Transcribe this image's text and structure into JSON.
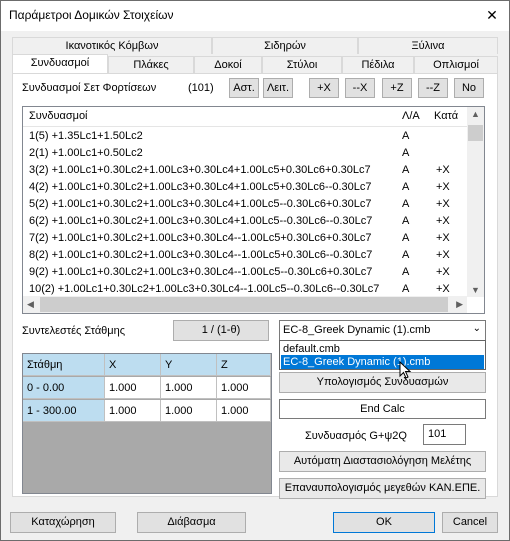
{
  "window": {
    "title": "Παράμετροι Δομικών Στοιχείων",
    "close_glyph": "✕"
  },
  "tabs_row1": [
    "Ικανοτικός Κόμβων",
    "Σιδηρών",
    "Ξύλινα"
  ],
  "tabs_row2": [
    "Συνδυασμοί",
    "Πλάκες",
    "Δοκοί",
    "Στύλοι",
    "Πέδιλα",
    "Οπλισμοί"
  ],
  "load_sets": {
    "label": "Συνδυασμοί Σετ Φορτίσεων",
    "count": "(101)",
    "buttons": [
      "Αστ.",
      "Λειτ.",
      "+X",
      "--X",
      "+Z",
      "--Z",
      "No"
    ]
  },
  "combos_list": {
    "headers": [
      "Συνδυασμοί",
      "Λ/Α",
      "Κατά"
    ],
    "rows": [
      {
        "expr": "1(5) +1.35Lc1+1.50Lc2",
        "la": "A",
        "kata": ""
      },
      {
        "expr": "2(1) +1.00Lc1+0.50Lc2",
        "la": "A",
        "kata": ""
      },
      {
        "expr": "3(2) +1.00Lc1+0.30Lc2+1.00Lc3+0.30Lc4+1.00Lc5+0.30Lc6+0.30Lc7",
        "la": "A",
        "kata": "+X"
      },
      {
        "expr": "4(2) +1.00Lc1+0.30Lc2+1.00Lc3+0.30Lc4+1.00Lc5+0.30Lc6--0.30Lc7",
        "la": "A",
        "kata": "+X"
      },
      {
        "expr": "5(2) +1.00Lc1+0.30Lc2+1.00Lc3+0.30Lc4+1.00Lc5--0.30Lc6+0.30Lc7",
        "la": "A",
        "kata": "+X"
      },
      {
        "expr": "6(2) +1.00Lc1+0.30Lc2+1.00Lc3+0.30Lc4+1.00Lc5--0.30Lc6--0.30Lc7",
        "la": "A",
        "kata": "+X"
      },
      {
        "expr": "7(2) +1.00Lc1+0.30Lc2+1.00Lc3+0.30Lc4--1.00Lc5+0.30Lc6+0.30Lc7",
        "la": "A",
        "kata": "+X"
      },
      {
        "expr": "8(2) +1.00Lc1+0.30Lc2+1.00Lc3+0.30Lc4--1.00Lc5+0.30Lc6--0.30Lc7",
        "la": "A",
        "kata": "+X"
      },
      {
        "expr": "9(2) +1.00Lc1+0.30Lc2+1.00Lc3+0.30Lc4--1.00Lc5--0.30Lc6+0.30Lc7",
        "la": "A",
        "kata": "+X"
      },
      {
        "expr": "10(2) +1.00Lc1+0.30Lc2+1.00Lc3+0.30Lc4--1.00Lc5--0.30Lc6--0.30Lc7",
        "la": "A",
        "kata": "+X"
      }
    ]
  },
  "level_factors": {
    "label": "Συντελεστές Στάθμης",
    "button": "1 / (1-θ)"
  },
  "level_table": {
    "headers": [
      "Στάθμη",
      "X",
      "Y",
      "Z"
    ],
    "rows": [
      [
        "0 - 0.00",
        "1.000",
        "1.000",
        "1.000"
      ],
      [
        "1 - 300.00",
        "1.000",
        "1.000",
        "1.000"
      ]
    ]
  },
  "combo_file": {
    "selected": "EC-8_Greek Dynamic (1).cmb",
    "options": [
      "default.cmb",
      "EC-8_Greek Dynamic (1).cmb"
    ]
  },
  "right_panel": {
    "calc_button": "Υπολογισμός Συνδυασμών",
    "end_calc": "End Calc",
    "g_psi_label": "Συνδυασμός G+ψ2Q",
    "g_psi_value": "101",
    "auto_design_button": "Αυτόματη Διαστασιολόγηση Μελέτης",
    "recalc_button": "Επαναυπολογισμός μεγεθών ΚΑΝ.ΕΠΕ."
  },
  "footer": {
    "save": "Καταχώρηση",
    "read": "Διάβασμα",
    "ok": "OK",
    "cancel": "Cancel"
  },
  "colors": {
    "selection": "#0078d7",
    "grid_header": "#bdddf0"
  }
}
